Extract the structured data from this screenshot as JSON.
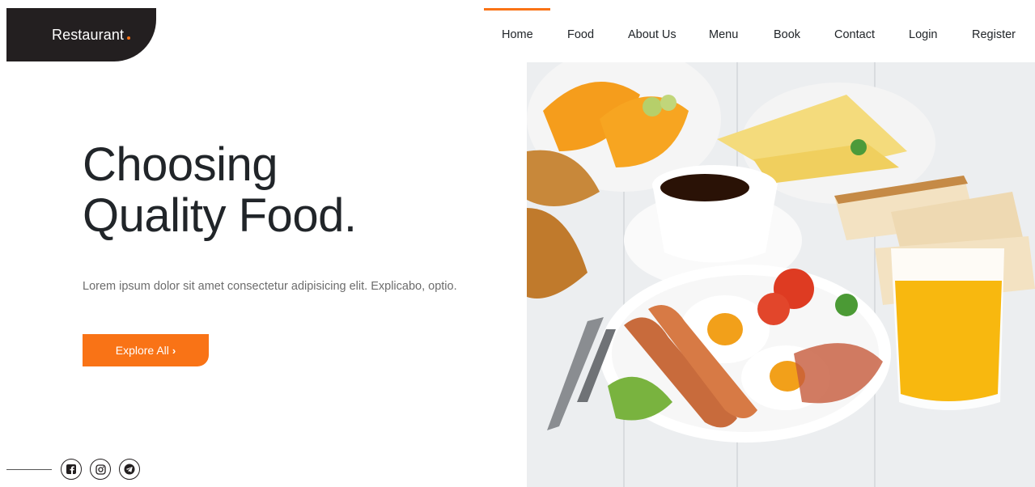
{
  "brand": {
    "name": "Restaurant",
    "accent_color": "#f97316",
    "dark_color": "#231f20"
  },
  "nav": {
    "items": [
      {
        "label": "Home",
        "active": true
      },
      {
        "label": "Food"
      },
      {
        "label": "About Us"
      },
      {
        "label": "Menu"
      },
      {
        "label": "Book"
      },
      {
        "label": "Contact"
      },
      {
        "label": "Login"
      },
      {
        "label": "Register"
      }
    ]
  },
  "hero": {
    "title_line1": "Choosing",
    "title_line2": "Quality Food.",
    "description": "Lorem ipsum dolor sit amet consectetur adipisicing elit. Explicabo, optio.",
    "cta_label": "Explore All",
    "cta_icon": "chevron-right-icon",
    "image_icon": "breakfast-photo"
  },
  "social": {
    "icons": [
      "facebook-icon",
      "instagram-icon",
      "telegram-icon"
    ]
  }
}
